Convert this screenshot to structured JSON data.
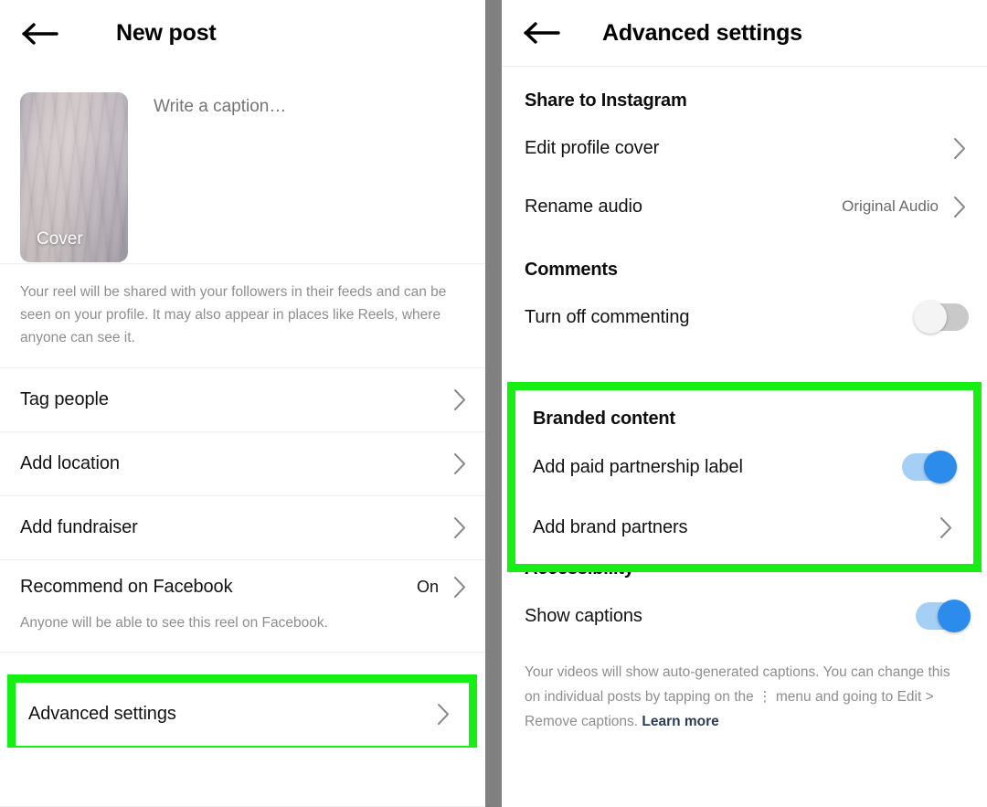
{
  "theme": {
    "highlight_green": "#14ef14",
    "toggle_on_track": "#a5cff5",
    "toggle_on_knob": "#2b8cec",
    "toggle_off_track": "#c9c9c9",
    "divider_gray": "#808080",
    "link_color": "#2c3e56"
  },
  "left_panel": {
    "header": {
      "title": "New post",
      "back_icon": "back-arrow-icon"
    },
    "composer": {
      "cover_label": "Cover",
      "caption_placeholder": "Write a caption…",
      "caption_value": ""
    },
    "share_note": "Your reel will be shared with your followers in their feeds and can be seen on your profile. It may also appear in places like Reels, where anyone can see it.",
    "rows": [
      {
        "label": "Tag people",
        "value": "",
        "chevron": true
      },
      {
        "label": "Add location",
        "value": "",
        "chevron": true
      },
      {
        "label": "Add fundraiser",
        "value": "",
        "chevron": true
      },
      {
        "label": "Recommend on Facebook",
        "value": "On",
        "chevron": true
      }
    ],
    "facebook_note": "Anyone will be able to see this reel on Facebook.",
    "advanced_settings": {
      "label": "Advanced settings",
      "chevron": true,
      "highlighted": true
    }
  },
  "right_panel": {
    "header": {
      "title": "Advanced settings",
      "back_icon": "back-arrow-icon"
    },
    "share_section": {
      "title": "Share to Instagram",
      "rows": [
        {
          "label": "Edit profile cover",
          "value": "",
          "chevron": true
        },
        {
          "label": "Rename audio",
          "value": "Original Audio",
          "chevron": true
        }
      ]
    },
    "comments_section": {
      "title": "Comments",
      "row": {
        "label": "Turn off commenting",
        "toggle": "off"
      }
    },
    "branded_section": {
      "title": "Branded content",
      "highlighted": true,
      "rows": [
        {
          "label": "Add paid partnership label",
          "toggle": "on"
        },
        {
          "label": "Add brand partners",
          "chevron": true
        }
      ]
    },
    "accessibility_section": {
      "title": "Accessibility",
      "row": {
        "label": "Show captions",
        "toggle": "on"
      },
      "footnote_part1": "Your videos will show auto-generated captions. You can change this on individual posts by tapping on the ",
      "footnote_kebab": "⋮",
      "footnote_part2": " menu and going to Edit > Remove captions. ",
      "footnote_link": "Learn more"
    }
  }
}
